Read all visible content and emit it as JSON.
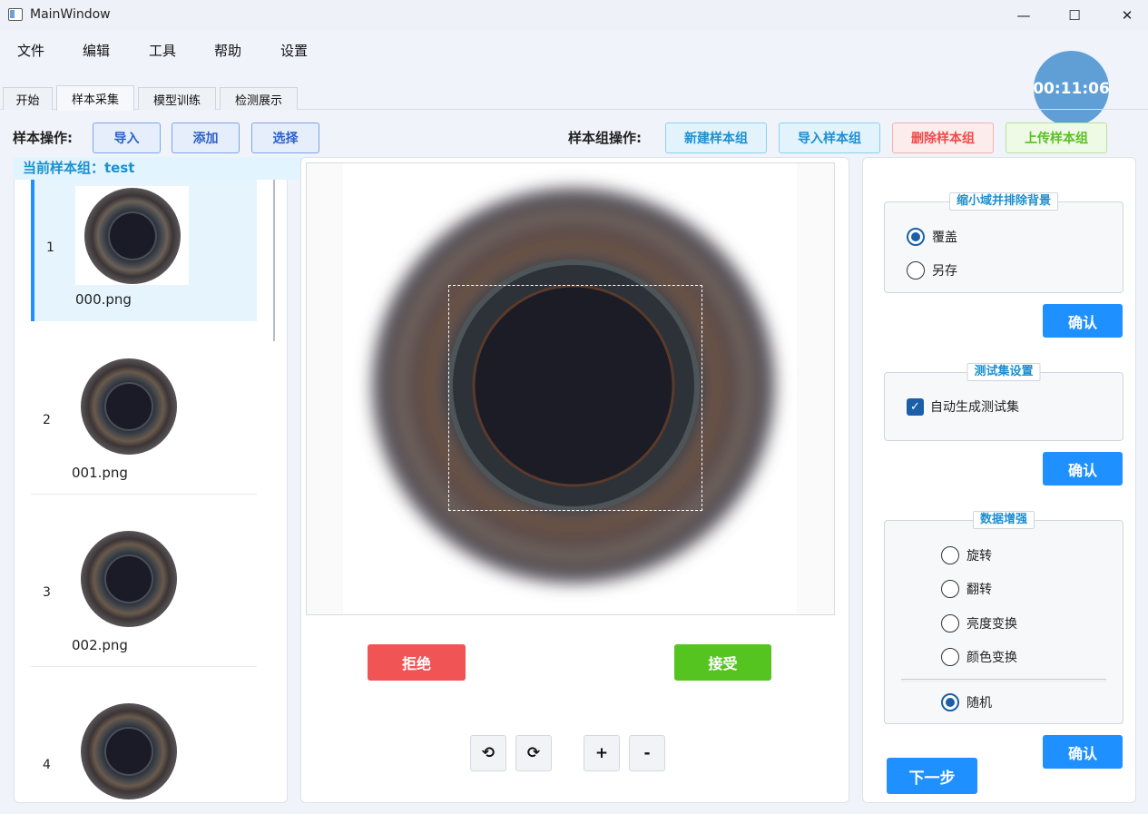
{
  "window": {
    "title": "MainWindow",
    "minimize": "—",
    "maximize": "☐",
    "close": "✕"
  },
  "menu": [
    "文件",
    "编辑",
    "工具",
    "帮助",
    "设置"
  ],
  "timer": "00:11:06",
  "tabs": [
    "开始",
    "样本采集",
    "模型训练",
    "检测展示"
  ],
  "sample_ops": {
    "label": "样本操作:",
    "import": "导入",
    "add": "添加",
    "select": "选择"
  },
  "group_ops": {
    "label": "样本组操作:",
    "new": "新建样本组",
    "import": "导入样本组",
    "delete": "删除样本组",
    "upload": "上传样本组"
  },
  "current_group": "当前样本组：test",
  "samples": [
    {
      "index": "1",
      "name": "000.png"
    },
    {
      "index": "2",
      "name": "001.png"
    },
    {
      "index": "3",
      "name": "002.png"
    },
    {
      "index": "4",
      "name": ""
    }
  ],
  "review": {
    "reject": "拒绝",
    "accept": "接受"
  },
  "tools": {
    "rotate_left": "⟲",
    "rotate_right": "⟳",
    "zoom_in": "+",
    "zoom_out": "-"
  },
  "roi": {
    "title": "缩小域并排除背景",
    "options": [
      "覆盖",
      "另存"
    ],
    "selected": "覆盖",
    "confirm": "确认"
  },
  "testset": {
    "title": "测试集设置",
    "option": "自动生成测试集",
    "checked": true,
    "confirm": "确认"
  },
  "augment": {
    "title": "数据增强",
    "options": [
      "旋转",
      "翻转",
      "亮度变换",
      "颜色变换"
    ],
    "random": "随机",
    "random_checked": true,
    "confirm": "确认"
  },
  "next": "下一步",
  "colors": {
    "accent": "#1e90ff",
    "reject": "#f05454",
    "accept": "#55c421",
    "timer": "#5f9fd6"
  }
}
